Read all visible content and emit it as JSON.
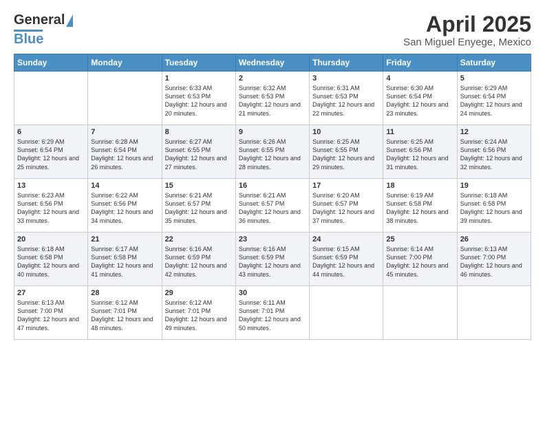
{
  "header": {
    "logo_line1": "General",
    "logo_line2": "Blue",
    "title": "April 2025",
    "location": "San Miguel Enyege, Mexico"
  },
  "days_of_week": [
    "Sunday",
    "Monday",
    "Tuesday",
    "Wednesday",
    "Thursday",
    "Friday",
    "Saturday"
  ],
  "weeks": [
    [
      {
        "day": "",
        "info": ""
      },
      {
        "day": "",
        "info": ""
      },
      {
        "day": "1",
        "info": "Sunrise: 6:33 AM\nSunset: 6:53 PM\nDaylight: 12 hours and 20 minutes."
      },
      {
        "day": "2",
        "info": "Sunrise: 6:32 AM\nSunset: 6:53 PM\nDaylight: 12 hours and 21 minutes."
      },
      {
        "day": "3",
        "info": "Sunrise: 6:31 AM\nSunset: 6:53 PM\nDaylight: 12 hours and 22 minutes."
      },
      {
        "day": "4",
        "info": "Sunrise: 6:30 AM\nSunset: 6:54 PM\nDaylight: 12 hours and 23 minutes."
      },
      {
        "day": "5",
        "info": "Sunrise: 6:29 AM\nSunset: 6:54 PM\nDaylight: 12 hours and 24 minutes."
      }
    ],
    [
      {
        "day": "6",
        "info": "Sunrise: 6:29 AM\nSunset: 6:54 PM\nDaylight: 12 hours and 25 minutes."
      },
      {
        "day": "7",
        "info": "Sunrise: 6:28 AM\nSunset: 6:54 PM\nDaylight: 12 hours and 26 minutes."
      },
      {
        "day": "8",
        "info": "Sunrise: 6:27 AM\nSunset: 6:55 PM\nDaylight: 12 hours and 27 minutes."
      },
      {
        "day": "9",
        "info": "Sunrise: 6:26 AM\nSunset: 6:55 PM\nDaylight: 12 hours and 28 minutes."
      },
      {
        "day": "10",
        "info": "Sunrise: 6:25 AM\nSunset: 6:55 PM\nDaylight: 12 hours and 29 minutes."
      },
      {
        "day": "11",
        "info": "Sunrise: 6:25 AM\nSunset: 6:56 PM\nDaylight: 12 hours and 31 minutes."
      },
      {
        "day": "12",
        "info": "Sunrise: 6:24 AM\nSunset: 6:56 PM\nDaylight: 12 hours and 32 minutes."
      }
    ],
    [
      {
        "day": "13",
        "info": "Sunrise: 6:23 AM\nSunset: 6:56 PM\nDaylight: 12 hours and 33 minutes."
      },
      {
        "day": "14",
        "info": "Sunrise: 6:22 AM\nSunset: 6:56 PM\nDaylight: 12 hours and 34 minutes."
      },
      {
        "day": "15",
        "info": "Sunrise: 6:21 AM\nSunset: 6:57 PM\nDaylight: 12 hours and 35 minutes."
      },
      {
        "day": "16",
        "info": "Sunrise: 6:21 AM\nSunset: 6:57 PM\nDaylight: 12 hours and 36 minutes."
      },
      {
        "day": "17",
        "info": "Sunrise: 6:20 AM\nSunset: 6:57 PM\nDaylight: 12 hours and 37 minutes."
      },
      {
        "day": "18",
        "info": "Sunrise: 6:19 AM\nSunset: 6:58 PM\nDaylight: 12 hours and 38 minutes."
      },
      {
        "day": "19",
        "info": "Sunrise: 6:18 AM\nSunset: 6:58 PM\nDaylight: 12 hours and 39 minutes."
      }
    ],
    [
      {
        "day": "20",
        "info": "Sunrise: 6:18 AM\nSunset: 6:58 PM\nDaylight: 12 hours and 40 minutes."
      },
      {
        "day": "21",
        "info": "Sunrise: 6:17 AM\nSunset: 6:58 PM\nDaylight: 12 hours and 41 minutes."
      },
      {
        "day": "22",
        "info": "Sunrise: 6:16 AM\nSunset: 6:59 PM\nDaylight: 12 hours and 42 minutes."
      },
      {
        "day": "23",
        "info": "Sunrise: 6:16 AM\nSunset: 6:59 PM\nDaylight: 12 hours and 43 minutes."
      },
      {
        "day": "24",
        "info": "Sunrise: 6:15 AM\nSunset: 6:59 PM\nDaylight: 12 hours and 44 minutes."
      },
      {
        "day": "25",
        "info": "Sunrise: 6:14 AM\nSunset: 7:00 PM\nDaylight: 12 hours and 45 minutes."
      },
      {
        "day": "26",
        "info": "Sunrise: 6:13 AM\nSunset: 7:00 PM\nDaylight: 12 hours and 46 minutes."
      }
    ],
    [
      {
        "day": "27",
        "info": "Sunrise: 6:13 AM\nSunset: 7:00 PM\nDaylight: 12 hours and 47 minutes."
      },
      {
        "day": "28",
        "info": "Sunrise: 6:12 AM\nSunset: 7:01 PM\nDaylight: 12 hours and 48 minutes."
      },
      {
        "day": "29",
        "info": "Sunrise: 6:12 AM\nSunset: 7:01 PM\nDaylight: 12 hours and 49 minutes."
      },
      {
        "day": "30",
        "info": "Sunrise: 6:11 AM\nSunset: 7:01 PM\nDaylight: 12 hours and 50 minutes."
      },
      {
        "day": "",
        "info": ""
      },
      {
        "day": "",
        "info": ""
      },
      {
        "day": "",
        "info": ""
      }
    ]
  ]
}
